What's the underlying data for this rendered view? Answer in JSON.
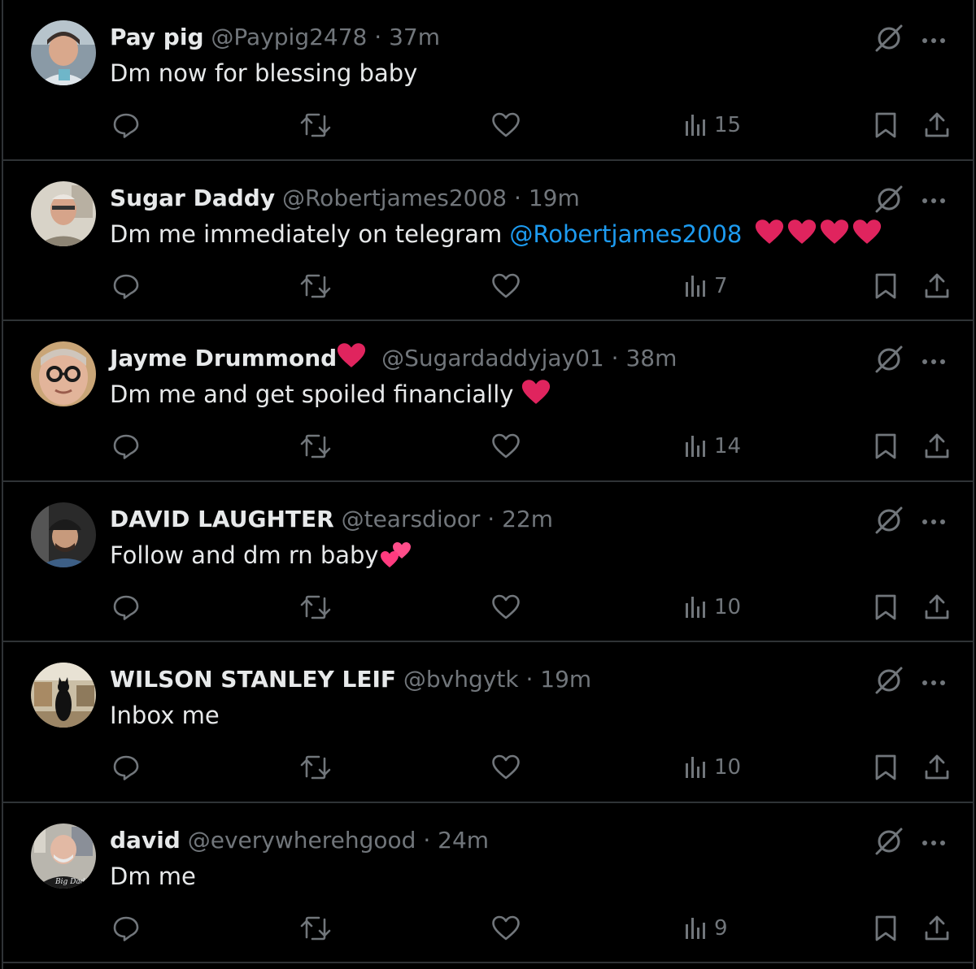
{
  "colors": {
    "background": "#000000",
    "divider": "#2f3336",
    "primary_text": "#e7e9ea",
    "secondary_text": "#71767b",
    "mention": "#1d9bf0",
    "heart_emoji": "#e0245e"
  },
  "icons": {
    "grok": "slashed-circle-icon",
    "more": "more-dots-icon",
    "reply": "reply-icon",
    "retweet": "retweet-icon",
    "like": "like-icon",
    "views": "views-bar-chart-icon",
    "bookmark": "bookmark-icon",
    "share": "share-icon"
  },
  "tweets": [
    {
      "name": "Pay pig",
      "handle": "@Paypig2478",
      "separator": "·",
      "time": "37m",
      "text": "Dm now for blessing baby",
      "views": "15"
    },
    {
      "name": "Sugar Daddy",
      "handle": "@Robertjames2008",
      "separator": "·",
      "time": "19m",
      "text": "Dm me immediately on telegram ",
      "mention": "@Robertjames2008",
      "views": "7"
    },
    {
      "name": "Jayme Drummond",
      "handle": "@Sugardaddyjay01",
      "separator": "·",
      "time": "38m",
      "text": "Dm me and get spoiled financially ",
      "views": "14"
    },
    {
      "name": "DAVID LAUGHTER",
      "handle": "@tearsdioor",
      "separator": "·",
      "time": "22m",
      "text": "Follow and dm rn baby",
      "emoji": "💕",
      "views": "10"
    },
    {
      "name": "WILSON STANLEY LEIF",
      "handle": "@bvhgytk",
      "separator": "·",
      "time": "19m",
      "text": "Inbox me",
      "views": "10"
    },
    {
      "name": "david",
      "handle": "@everywherehgood",
      "separator": "·",
      "time": "24m",
      "text": "Dm me",
      "avatar_text": "Big Daddy",
      "views": "9"
    }
  ]
}
